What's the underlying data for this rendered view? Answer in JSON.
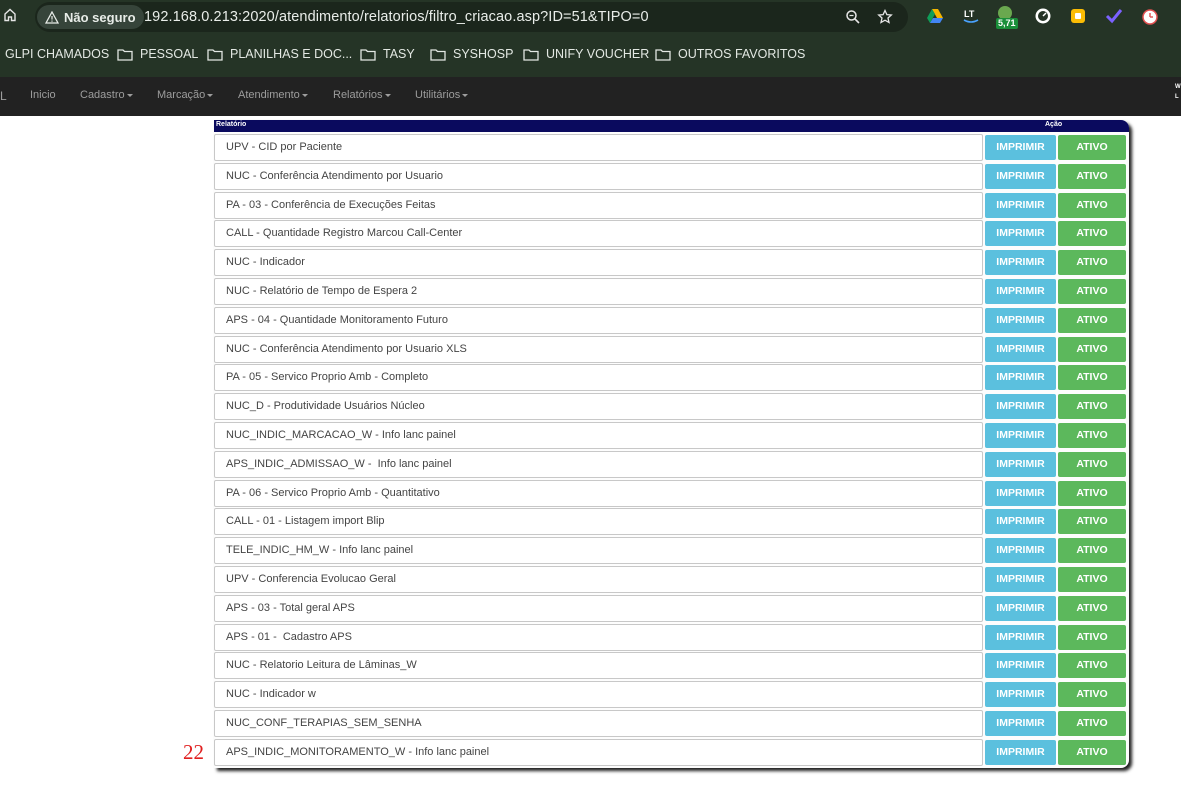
{
  "browser": {
    "security_label": "Não seguro",
    "url": "192.168.0.213:2020/atendimento/relatorios/filtro_criacao.asp?ID=51&TIPO=0",
    "extension_badge": "5,71",
    "bookmarks": [
      "GLPI CHAMADOS",
      "PESSOAL",
      "PLANILHAS E DOC...",
      "TASY",
      "SYSHOSP",
      "UNIFY VOUCHER",
      "OUTROS FAVORITOS"
    ]
  },
  "navbar": {
    "brand_fragment": "L",
    "items": [
      {
        "label": "Inicio"
      },
      {
        "label": "Cadastro"
      },
      {
        "label": "Marcação"
      },
      {
        "label": "Atendimento"
      },
      {
        "label": "Relatórios"
      },
      {
        "label": "Utilitários"
      }
    ]
  },
  "table": {
    "header_report": "Relatório",
    "header_action": "Ação",
    "print_label": "IMPRIMIR",
    "active_label": "ATIVO",
    "rows": [
      "UPV - CID por Paciente",
      "NUC - Conferência Atendimento por Usuario",
      "PA - 03 - Conferência de Execuções Feitas",
      "CALL - Quantidade Registro Marcou Call-Center",
      "NUC - Indicador",
      "NUC - Relatório de Tempo de Espera 2",
      "APS - 04 - Quantidade Monitoramento Futuro",
      "NUC - Conferência Atendimento por Usuario XLS",
      "PA - 05 - Servico Proprio Amb - Completo",
      "NUC_D - Produtividade Usuários Núcleo",
      "NUC_INDIC_MARCACAO_W - Info lanc painel",
      "APS_INDIC_ADMISSAO_W -  Info lanc painel",
      "PA - 06 - Servico Proprio Amb - Quantitativo",
      "CALL - 01 - Listagem import Blip",
      "TELE_INDIC_HM_W - Info lanc painel",
      "UPV - Conferencia Evolucao Geral",
      "APS - 03 - Total geral APS",
      "APS - 01 -  Cadastro APS",
      "NUC - Relatorio Leitura de Lâminas_W",
      "NUC - Indicador w",
      "NUC_CONF_TERAPIAS_SEM_SENHA",
      "APS_INDIC_MONITORAMENTO_W - Info lanc painel"
    ]
  },
  "annotation": "22",
  "colors": {
    "print": "#5bc0de",
    "active": "#5cb85c",
    "header": "#0a0a5e",
    "annotation": "#e02020"
  }
}
